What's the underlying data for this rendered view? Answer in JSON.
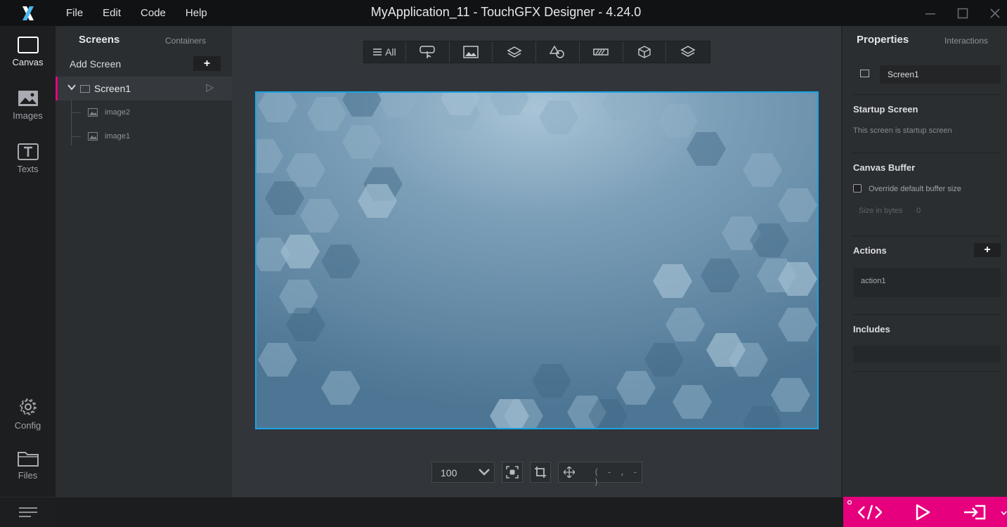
{
  "window": {
    "title": "MyApplication_11 - TouchGFX Designer - 4.24.0",
    "menu": [
      "File",
      "Edit",
      "Code",
      "Help"
    ]
  },
  "leftnav": {
    "canvas": "Canvas",
    "images": "Images",
    "texts": "Texts",
    "config": "Config",
    "files": "Files"
  },
  "tree": {
    "tab_screens": "Screens",
    "tab_containers": "Containers",
    "add_screen": "Add Screen",
    "screen_name": "Screen1",
    "children": [
      "image2",
      "image1"
    ]
  },
  "toolbar": {
    "all_label": "All",
    "icons": [
      "all-icon",
      "button-icon",
      "image-icon",
      "container-icon",
      "shapes-icon",
      "progress-icon",
      "3d-icon",
      "layers-icon"
    ]
  },
  "canvas_controls": {
    "zoom": "100",
    "coords": "( - , - )"
  },
  "properties": {
    "title": "Properties",
    "interactions_tab": "Interactions",
    "name_value": "Screen1",
    "startup_heading": "Startup Screen",
    "startup_text": "This screen is startup screen",
    "buffer_heading": "Canvas Buffer",
    "buffer_checkbox_label": "Override default buffer size",
    "size_label": "Size in bytes",
    "size_value": "0",
    "actions_heading": "Actions",
    "action_item": "action1",
    "includes_heading": "Includes"
  },
  "colors": {
    "accent": "#e6007e",
    "selection": "#1aa3e6",
    "canvas_bg": "#5f88a6"
  }
}
